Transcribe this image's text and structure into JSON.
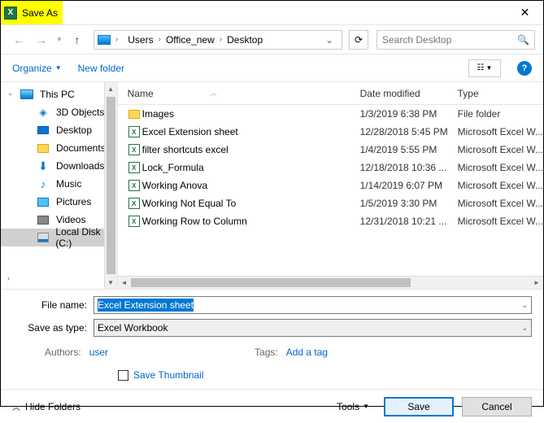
{
  "title": "Save As",
  "breadcrumb": {
    "seg1": "Users",
    "seg2": "Office_new",
    "seg3": "Desktop"
  },
  "search": {
    "placeholder": "Search Desktop"
  },
  "toolbar": {
    "organize": "Organize",
    "newfolder": "New folder"
  },
  "tree": {
    "thispc": "This PC",
    "objects3d": "3D Objects",
    "desktop": "Desktop",
    "documents": "Documents",
    "downloads": "Downloads",
    "music": "Music",
    "pictures": "Pictures",
    "videos": "Videos",
    "localdisk": "Local Disk (C:)"
  },
  "headers": {
    "name": "Name",
    "date": "Date modified",
    "type": "Type"
  },
  "files": [
    {
      "icon": "folder",
      "name": "Images",
      "date": "1/3/2019 6:38 PM",
      "type": "File folder"
    },
    {
      "icon": "excel",
      "name": "Excel Extension sheet",
      "date": "12/28/2018 5:45 PM",
      "type": "Microsoft Excel W..."
    },
    {
      "icon": "excel",
      "name": "filter shortcuts excel",
      "date": "1/4/2019 5:55 PM",
      "type": "Microsoft Excel W..."
    },
    {
      "icon": "excel",
      "name": "Lock_Formula",
      "date": "12/18/2018 10:36 ...",
      "type": "Microsoft Excel W..."
    },
    {
      "icon": "excel",
      "name": "Working Anova",
      "date": "1/14/2019 6:07 PM",
      "type": "Microsoft Excel W..."
    },
    {
      "icon": "excel",
      "name": "Working Not Equal To",
      "date": "1/5/2019 3:30 PM",
      "type": "Microsoft Excel W..."
    },
    {
      "icon": "excel",
      "name": "Working Row to Column",
      "date": "12/31/2018 10:21 ...",
      "type": "Microsoft Excel W..."
    }
  ],
  "filename": {
    "label": "File name:",
    "value": "Excel Extension sheet"
  },
  "savetype": {
    "label": "Save as type:",
    "value": "Excel Workbook"
  },
  "meta": {
    "authors_label": "Authors:",
    "authors_value": "user",
    "tags_label": "Tags:",
    "tags_value": "Add a tag"
  },
  "thumbnail": "Save Thumbnail",
  "footer": {
    "hide": "Hide Folders",
    "tools": "Tools",
    "save": "Save",
    "cancel": "Cancel"
  }
}
